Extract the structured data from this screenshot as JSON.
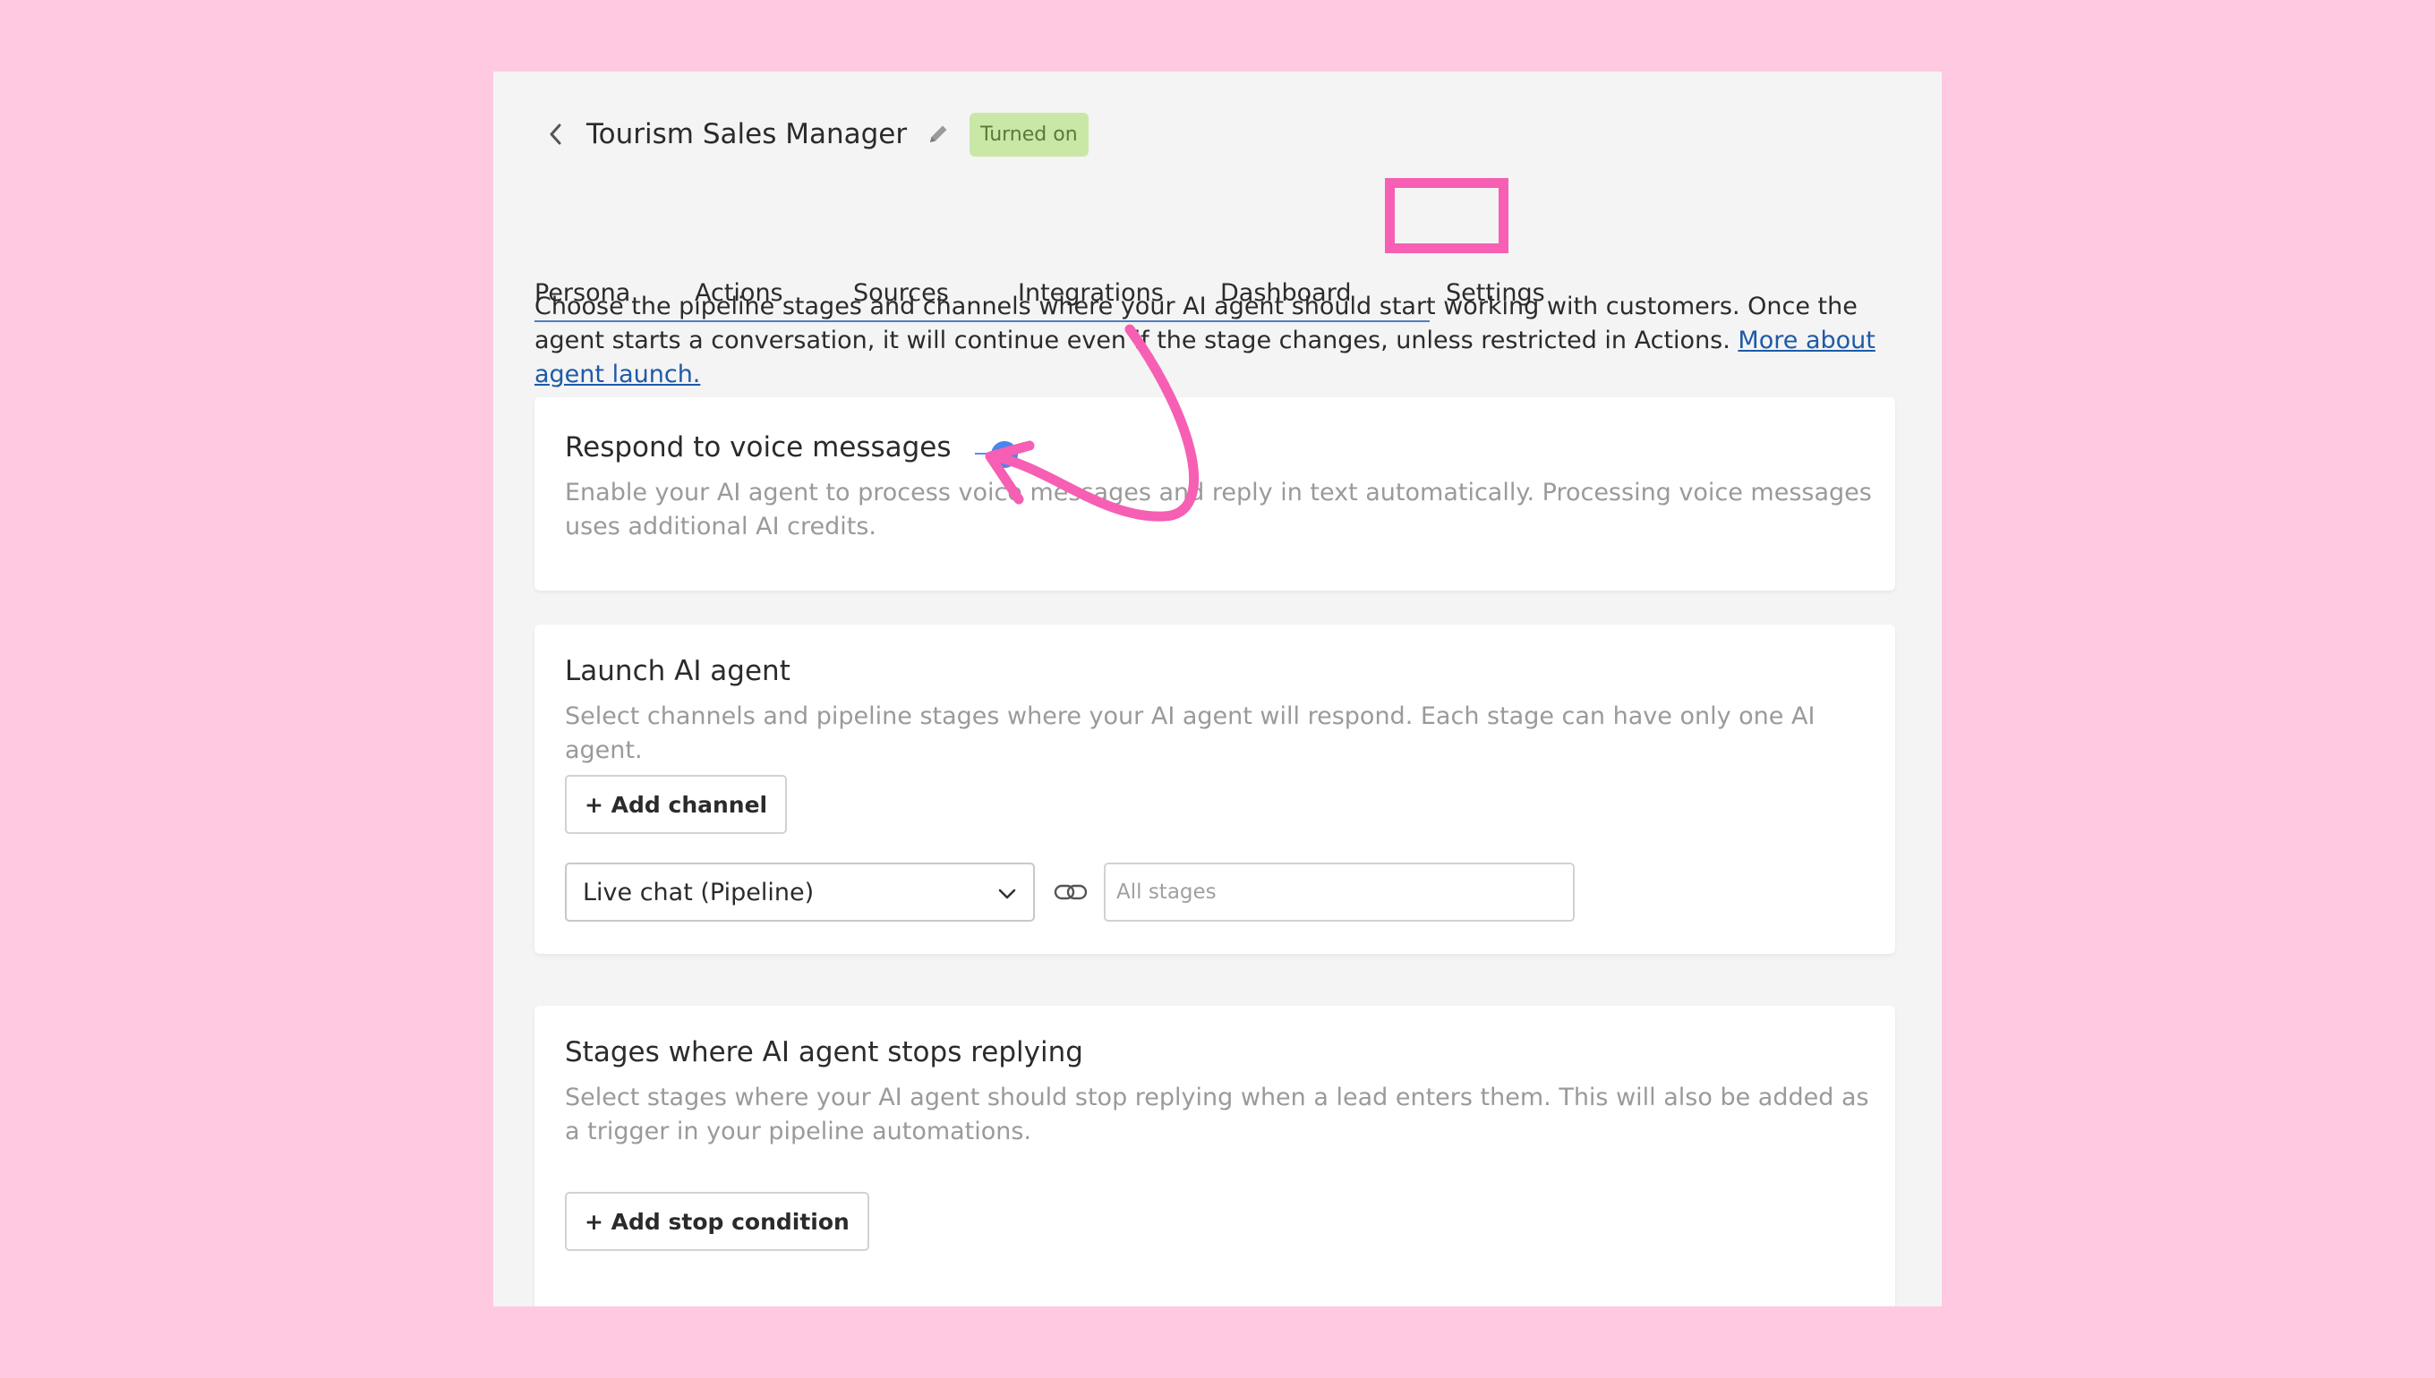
{
  "header": {
    "title": "Tourism Sales Manager",
    "status_badge": "Turned on"
  },
  "tabs": [
    {
      "label": "Persona"
    },
    {
      "label": "Actions"
    },
    {
      "label": "Sources"
    },
    {
      "label": "Integrations"
    },
    {
      "label": "Dashboard"
    },
    {
      "label": "Settings",
      "active": true
    }
  ],
  "intro": {
    "text": "Choose the pipeline stages and channels where your AI agent should start working with customers. Once the agent starts a conversation, it will continue even if the stage changes, unless restricted in Actions. ",
    "link_label": "More about agent launch."
  },
  "voice_card": {
    "title": "Respond to voice messages",
    "toggle_on": true,
    "description": "Enable your AI agent to process voice messages and reply in text automatically. Processing voice messages uses additional AI credits."
  },
  "launch_card": {
    "title": "Launch AI agent",
    "description": "Select channels and pipeline stages where your AI agent will respond. Each stage can have only one AI agent.",
    "add_channel_label": "+ Add channel",
    "channel_select_value": "Live chat (Pipeline)",
    "stages_placeholder": "All stages"
  },
  "stop_card": {
    "title": "Stages where AI agent stops replying",
    "description": "Select stages where your AI agent should stop replying when a lead enters them. This will also be added as a trigger in your pipeline automations.",
    "add_stop_label": "+ Add stop condition"
  },
  "colors": {
    "background": "#ffc9e1",
    "accent": "#4a86ee",
    "highlight": "#f65fb3",
    "badge_bg": "#c9e8a6"
  },
  "icons": [
    "chevron-left-icon",
    "pencil-icon",
    "chevron-down-icon",
    "link-icon"
  ]
}
